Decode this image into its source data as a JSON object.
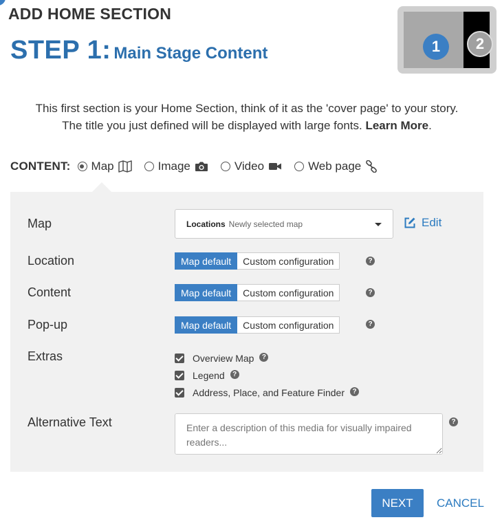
{
  "header": {
    "title": "ADD HOME SECTION"
  },
  "step": {
    "number": "STEP 1:",
    "subtitle": "Main Stage Content"
  },
  "thumbnail": {
    "steps": [
      "1",
      "2"
    ]
  },
  "intro": {
    "line1": "This first section is your Home Section, think of it as the 'cover page' to your story.",
    "line2": "The title you just defined will be displayed with large fonts.",
    "learn_more": "Learn More",
    "trailing": "."
  },
  "content": {
    "label": "CONTENT:",
    "options": [
      {
        "label": "Map",
        "icon": "map-icon",
        "selected": true
      },
      {
        "label": "Image",
        "icon": "camera-icon",
        "selected": false
      },
      {
        "label": "Video",
        "icon": "video-camera-icon",
        "selected": false
      },
      {
        "label": "Web page",
        "icon": "link-icon",
        "selected": false
      }
    ]
  },
  "form": {
    "map": {
      "label": "Map",
      "select_name": "Locations",
      "select_sub": "Newly selected map",
      "edit_label": "Edit"
    },
    "location": {
      "label": "Location",
      "opt_default": "Map default",
      "opt_custom": "Custom configuration"
    },
    "content": {
      "label": "Content",
      "opt_default": "Map default",
      "opt_custom": "Custom configuration"
    },
    "popup": {
      "label": "Pop-up",
      "opt_default": "Map default",
      "opt_custom": "Custom configuration"
    },
    "extras": {
      "label": "Extras",
      "items": [
        {
          "label": "Overview Map",
          "checked": true
        },
        {
          "label": "Legend",
          "checked": true
        },
        {
          "label": "Address, Place, and Feature Finder",
          "checked": true
        }
      ]
    },
    "alt_text": {
      "label": "Alternative Text",
      "placeholder": "Enter a description of this media for visually impaired readers..."
    }
  },
  "footer": {
    "next_label": "NEXT",
    "cancel_label": "CANCEL"
  },
  "colors": {
    "accent": "#3b7fc4",
    "link": "#2c7bc0",
    "panel_bg": "#f1f1f1"
  },
  "help_glyph": "?"
}
